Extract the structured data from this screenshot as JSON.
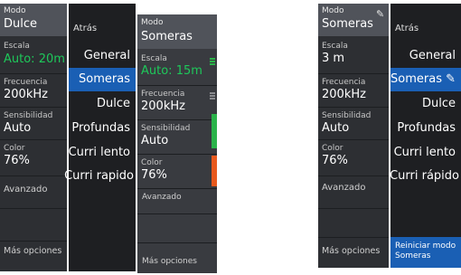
{
  "left_panel": {
    "mode_label": "Modo",
    "mode_value": "Dulce",
    "scale_label": "Escala",
    "scale_value": "Auto: 20m",
    "freq_label": "Frecuencia",
    "freq_value": "200kHz",
    "sens_label": "Sensibilidad",
    "sens_value": "Auto",
    "color_label": "Color",
    "color_value": "76%",
    "advanced": "Avanzado",
    "more": "Más opciones"
  },
  "left_menu": {
    "back": "Atrás",
    "items": [
      "General",
      "Someras",
      "Dulce",
      "Profundas",
      "Curri lento",
      "Curri rapido"
    ],
    "selected_index": 1
  },
  "overlay_panel": {
    "mode_label": "Modo",
    "mode_value": "Someras",
    "scale_label": "Escala",
    "scale_value": "Auto: 15m",
    "freq_label": "Frecuencia",
    "freq_value": "200kHz",
    "sens_label": "Sensibilidad",
    "sens_value": "Auto",
    "color_label": "Color",
    "color_value": "76%",
    "advanced": "Avanzado",
    "more": "Más opciones"
  },
  "right_panel": {
    "mode_label": "Modo",
    "mode_value": "Someras",
    "scale_label": "Escala",
    "scale_value": "3 m",
    "freq_label": "Frecuencia",
    "freq_value": "200kHz",
    "sens_label": "Sensibilidad",
    "sens_value": "Auto",
    "color_label": "Color",
    "color_value": "76%",
    "advanced": "Avanzado",
    "more": "Más opciones"
  },
  "right_menu": {
    "back": "Atrás",
    "items": [
      "General",
      "Someras ✎",
      "Dulce",
      "Profundas",
      "Curri lento",
      "Curri rápido"
    ],
    "selected_index": 1,
    "reset_button": "Reiniciar modo Someras"
  },
  "colors": {
    "accent": "#1a5fb4",
    "green_text": "#1ec85a",
    "green_bar": "#2bb34a",
    "orange_bar": "#e85a1e"
  }
}
